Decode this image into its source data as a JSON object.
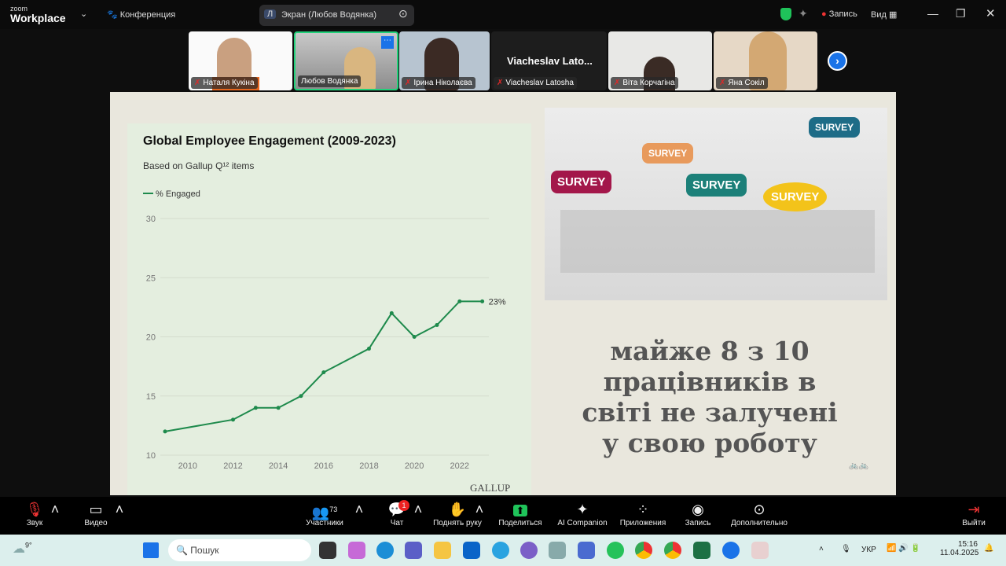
{
  "topbar": {
    "brand_small": "zoom",
    "brand": "Workplace",
    "meeting_label": "Конференция",
    "screen_initial": "Л",
    "screen_label": "Экран (Любов Водянка)",
    "record_label": "Запись",
    "view_label": "Вид"
  },
  "participants": [
    {
      "name": "Наталя Кукіна",
      "muted": true
    },
    {
      "name": "Любов Водянка",
      "muted": false
    },
    {
      "name": "Ірина Ніколаєва",
      "muted": true
    },
    {
      "name": "Viacheslav Latosha",
      "display": "Viacheslav  Lato...",
      "muted": true
    },
    {
      "name": "Віта Корчагіна",
      "muted": true
    },
    {
      "name": "Яна Сокіл",
      "muted": true
    }
  ],
  "chart_data": {
    "type": "line",
    "title": "Global Employee Engagement (2009-2023)",
    "subtitle": "Based on Gallup Q¹² items",
    "legend": [
      "% Engaged"
    ],
    "source": "GALLUP",
    "end_label": "23%",
    "x": [
      2009,
      2012,
      2013,
      2014,
      2015,
      2016,
      2018,
      2019,
      2020,
      2021,
      2022,
      2023
    ],
    "series": [
      {
        "name": "% Engaged",
        "values": [
          12,
          13,
          14,
          14,
          15,
          17,
          19,
          22,
          20,
          21,
          23,
          23
        ]
      }
    ],
    "xticks": [
      "2010",
      "2012",
      "2014",
      "2016",
      "2018",
      "2020",
      "2022"
    ],
    "yticks": [
      "10",
      "15",
      "20",
      "25",
      "30"
    ],
    "ylim": [
      10,
      30
    ],
    "xlim": [
      2009,
      2023
    ],
    "grid": true,
    "color": "#1e8a4c"
  },
  "slide": {
    "signs": [
      "SURVEY",
      "SURVEY",
      "SURVEY",
      "SURVEY",
      "SURVEY"
    ],
    "quote": [
      "майже 8 з 10",
      "працівників в",
      "світі не залучені",
      "у свою роботу"
    ]
  },
  "toolbar": {
    "audio": "Звук",
    "video": "Видео",
    "participants": "Участники",
    "participants_count": "73",
    "chat": "Чат",
    "chat_badge": "1",
    "raise_hand": "Поднять руку",
    "share": "Поделиться",
    "ai": "AI Companion",
    "apps": "Приложения",
    "record": "Запись",
    "more": "Дополнительно",
    "leave": "Выйти"
  },
  "taskbar": {
    "weather": "9°",
    "search_placeholder": "Пошук",
    "lang": "УКР",
    "time": "15:16",
    "date": "11.04.2025"
  }
}
